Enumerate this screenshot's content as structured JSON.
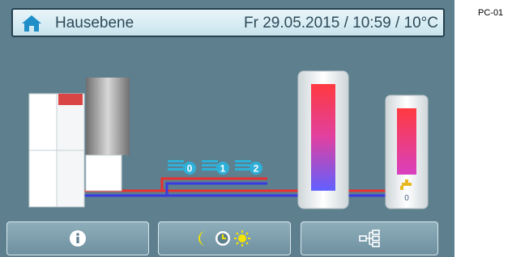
{
  "header": {
    "title": "Hausebene",
    "datetime": "Fr 29.05.2015 / 10:59 /  10°C"
  },
  "page_id": "PC-01",
  "heating_circuits": [
    {
      "number": "0",
      "icon": "radiator-icon"
    },
    {
      "number": "1",
      "icon": "radiator-icon"
    },
    {
      "number": "2",
      "icon": "radiator-icon"
    }
  ],
  "dhw_tank": {
    "value": "0",
    "icon": "faucet-icon"
  },
  "footer": {
    "buttons": [
      {
        "name": "info-button",
        "icon": "info-icon"
      },
      {
        "name": "time-program-button",
        "icon": "moon-clock-sun-icon"
      },
      {
        "name": "system-overview-button",
        "icon": "hierarchy-icon"
      }
    ]
  },
  "colors": {
    "background": "#5e7f8e",
    "flow_pipe": "#e83030",
    "return_pipe": "#3a3ae0",
    "header_text": "#2e4a59"
  }
}
